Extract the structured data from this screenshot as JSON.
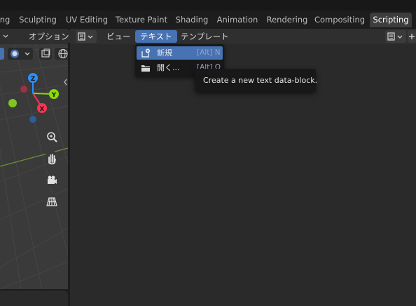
{
  "workspace_tabs": [
    {
      "label": "ng",
      "active": false
    },
    {
      "label": "Sculpting",
      "active": false
    },
    {
      "label": "UV Editing",
      "active": false
    },
    {
      "label": "Texture Paint",
      "active": false
    },
    {
      "label": "Shading",
      "active": false
    },
    {
      "label": "Animation",
      "active": false
    },
    {
      "label": "Rendering",
      "active": false
    },
    {
      "label": "Compositing",
      "active": false
    },
    {
      "label": "Scripting",
      "active": true
    }
  ],
  "viewport_header": {
    "options_label": "オプション"
  },
  "text_editor_header": {
    "menus": [
      "ビュー",
      "テキスト",
      "テンプレート"
    ],
    "open_menu": "テキスト"
  },
  "text_menu": {
    "items": [
      {
        "label": "新規",
        "shortcut": "[Alt] N",
        "icon": "new-text-icon",
        "highlighted": true
      },
      {
        "label": "開く...",
        "shortcut": "[Alt] O",
        "icon": "folder-icon",
        "highlighted": false
      }
    ]
  },
  "tooltip": {
    "text": "Create a new text data-block."
  },
  "gizmo": {
    "axes": [
      "Z",
      "Y",
      "X"
    ],
    "colors": {
      "x": "#ff3352",
      "y": "#8bdc00",
      "z": "#2890ff"
    }
  },
  "colors": {
    "accent": "#4772b3",
    "active_tab": "#3d3d3d",
    "panel": "#2a2a2a",
    "header": "#2f2f2f"
  }
}
